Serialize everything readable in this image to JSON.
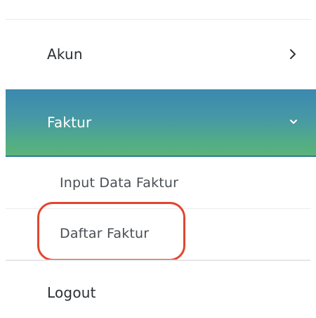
{
  "menu": {
    "items": [
      {
        "label": "Akun",
        "icon": "chevron-right-icon"
      },
      {
        "label": "Faktur",
        "icon": "chevron-down-icon",
        "active": true,
        "submenu": [
          {
            "label": "Input Data Faktur"
          },
          {
            "label": "Daftar Faktur",
            "highlighted": true
          }
        ]
      },
      {
        "label": "Logout"
      }
    ]
  },
  "colors": {
    "active_gradient_top": "#3b88b0",
    "active_gradient_bottom": "#5bb27a",
    "highlight_ring": "#e2452f",
    "text": "#2b2f33"
  }
}
